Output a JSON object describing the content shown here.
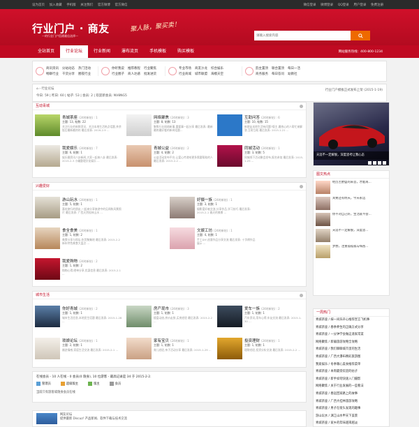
{
  "topbar": {
    "left": [
      "设为首页",
      "加入收藏",
      "手机版",
      "关注我们",
      "官方微博",
      "官方微信"
    ],
    "right": [
      "微信登录",
      "微博登录",
      "QQ登录",
      "用户登录",
      "免费注册"
    ]
  },
  "header": {
    "logo": "行业门户 · 商友",
    "tagline": "—的行业门户搭建最佳选择—",
    "slogan": "聚人脉，聚买卖！",
    "search_placeholder": "请输入搜索内容",
    "search_button": "搜索"
  },
  "nav": {
    "items": [
      "全站首页",
      "行业论坛",
      "行业新闻",
      "瀑布流页",
      "手机模板",
      "购买模板"
    ],
    "active": 1,
    "hotline": "网站服务热线：400-800-1234"
  },
  "subnav": [
    {
      "items": [
        "商讯资讯",
        "分站动态",
        "热门活动",
        "畅聊行业",
        "干货分享",
        "圈夜行业"
      ]
    },
    {
      "items": [
        "你听我说",
        "推荐教程",
        "行业聚焦",
        "行业圈子",
        "商人达惑",
        "批发进货"
      ]
    },
    {
      "items": [
        "专业市场",
        "商友沙龙",
        "综合娱乐",
        "行业商城",
        "城市联盟",
        "海模天空"
      ]
    },
    {
      "items": [
        "韵主置顶",
        "联合置顶",
        "每日一活",
        "商务服务",
        "每日答问",
        "幼教社"
      ]
    }
  ],
  "crumb": {
    "path": "⌂ › 行业论坛",
    "stats": "今日: 59 | 昨日: 60 | 帖子: 53 | 会员: 2 | 欢迎新会员: NV8NG5",
    "newthread": "行业门户模板正式发布上架 (2015-1-19)"
  },
  "sections": [
    {
      "title": "互动青城",
      "forums": [
        {
          "name": "青城茶座",
          "badge": "(24时新帖) : 1",
          "stats": "主题: 13, 帖数: 22",
          "desc": "关注行业的新鲜资讯、关注本地生活热点话题,茶余饭后最新最热的 最后发表: 2016-2-9 ..."
        },
        {
          "name": "网络聚焦",
          "badge": "(24时新帖) : 3",
          "stats": "主题: 8, 帖数: 13",
          "desc": "聚焦行业网络新事,重要事一起分享 最后发表: 最新最热最好看的新闻话题..."
        },
        {
          "name": "互助问答",
          "badge": "(24时新帖) : 6",
          "stats": "主题: 10, 帖数: 15",
          "desc": "新朋友本地生活有问题?版主,最热心的人帮忙来解答,互帮互助 最后发表: 2015-1-21 ..."
        },
        {
          "name": "我爱娱乐",
          "badge": "(24时新帖) : 7",
          "stats": "主题: 6, 帖数: 1",
          "desc": "娱乐圈资讯八卦新闻,大家一起来八卦 最后发表: 2015-2-3 小编整理文化娱乐 ..."
        },
        {
          "name": "青城公益",
          "badge": "(24时新帖) : 2",
          "stats": "主题: 4, 帖数: 2",
          "desc": "公益活动发布平台,让爱心传递给更多需要帮助的人 最后发表: 2015-2-2 ..."
        },
        {
          "name": "同城活动",
          "badge": "(24时新帖) : 1",
          "stats": "主题: 3, 帖数: 5",
          "desc": "同城线下活动聚会发布,报名参加 最后发表: 2015-1-25 ..."
        }
      ]
    },
    {
      "title": "兴趣爱好",
      "forums": [
        {
          "name": "游山玩水",
          "badge": "(24时新帖) : 1",
          "stats": "主题: 5, 帖数: 1",
          "desc": "喜欢旅行的朋友,一起来分享旅途中的见闻和风景照片 最后发表: 广西天然桂林山水 ..."
        },
        {
          "name": "好摄一族",
          "badge": "(24时新帖) : 1",
          "stats": "主题: 3, 帖数: 1",
          "desc": "摄影爱好者交流,分享作品,学习技巧 最后发表: 2015-2-1 春天的美景 ..."
        },
        {
          "name": "食全食美",
          "badge": "(24时新帖) : 1",
          "stats": "主题: 1, 帖数: 2",
          "desc": "美食分享与探店,吃货聚集地 最后发表: 2015-2-2 新年特色美食大盘点 ..."
        },
        {
          "name": "文娱工坊",
          "badge": "(24时新帖) : 1",
          "stats": "主题: 4, 帖数: 1",
          "desc": "手工DIY,创意作品分享交流 最后发表: 十字绣作品展示 ..."
        },
        {
          "name": "我爱购物",
          "badge": "(24时新帖) : 2",
          "stats": "主题: 1, 帖数: 2",
          "desc": "购物心得,晒单分享,优惠信息 最后发表: 2015-2-1 ..."
        }
      ]
    },
    {
      "title": "城市生活",
      "forums": [
        {
          "name": "你好青城",
          "badge": "(24时新帖) : 2",
          "stats": "主题: 1, 帖数: 1",
          "desc": "城市生活信息,本地民生话题 最后发表: 2015-1-28 ..."
        },
        {
          "name": "房产现市",
          "badge": "(24时新帖) : 3",
          "stats": "主题: 1, 帖数: 1",
          "desc": "楼盘动态,房价走势,买房经验 最后发表: 2015-2-2 ..."
        },
        {
          "name": "爱车一族",
          "badge": "(24时新帖) : 2",
          "stats": "主题: 1, 帖数: 1",
          "desc": "汽车资讯,用车心得,车友交流 最后发表: 2015-1-30 ..."
        },
        {
          "name": "琐娘论坛",
          "badge": "(24时新帖) : 1",
          "stats": "主题: 2, 帖数: 1",
          "desc": "婚恋情感,家庭生活交流 最后发表: 2015-2-1 ..."
        },
        {
          "name": "家有宝贝",
          "badge": "(24时新帖) : 1",
          "stats": "主题: 1, 帖数: 1",
          "desc": "育儿经验,亲子活动分享 最后发表: 2015-1-29 ..."
        },
        {
          "name": "投资理财",
          "badge": "(24时新帖) : 1",
          "stats": "主题: 1, 帖数: 1",
          "desc": "理财经验,投资分析交流 最后发表: 2015-2-2 ..."
        }
      ]
    }
  ],
  "side": {
    "banner_caption": "天涯不一定解脱，深度思考让我心态",
    "news_title": "图文热点",
    "news": [
      "经历苦野盛的来菩，才能再…",
      "宾要还有明天，今天永远",
      "你不对自己好，生活就不会…",
      "天涯不一定解脱，深度思…",
      "梦想，注重孤孤孤与嗨茜…"
    ],
    "hot_title": "一周热门",
    "hot": [
      "青城茶座 / 嫁一间乐开心推荐宣言飞机事",
      "青城茶座 / 春季养生的正确方式分享",
      "青城茶座 / 一分钟学会做这道家常菜",
      "网络聚焦 / 新疆旅游攻略全攻略",
      "青城茶座 / 我们聊聊城市里的生活",
      "青城茶座 / 广西大瀑布精彩旅游图",
      "我爱娱乐 / 冬季暖心美食推荐菜单",
      "青城茶座 / 本周最受欢迎的帖子",
      "青城茶座 / 新手如何快速入门摄影",
      "网络聚焦 / 关于行业发展的一些看法",
      "青城茶座 / 春运回家路上的故事",
      "青城茶座 / 广西大桂林旅游攻略",
      "青城茶座 / 男子在街头发现的趣事",
      "游山玩水 / 漓江山水甲天下美景",
      "青城茶座 / 家乡的年味越来越淡"
    ]
  },
  "online": {
    "header": "在线会员 - 10 人在线 - 0 会员(0 隐身), 10 位游客 - 最高记录是 34 于 2015-2-2.",
    "roles": [
      "管理员",
      "超级版主",
      "版主",
      "会员"
    ],
    "note": "当前只有游客或隐身会员在线"
  },
  "footer": {
    "title": "网友论坛",
    "desc": "提供最新 Discuz! 产品新闻、软件下载与技术交流"
  }
}
